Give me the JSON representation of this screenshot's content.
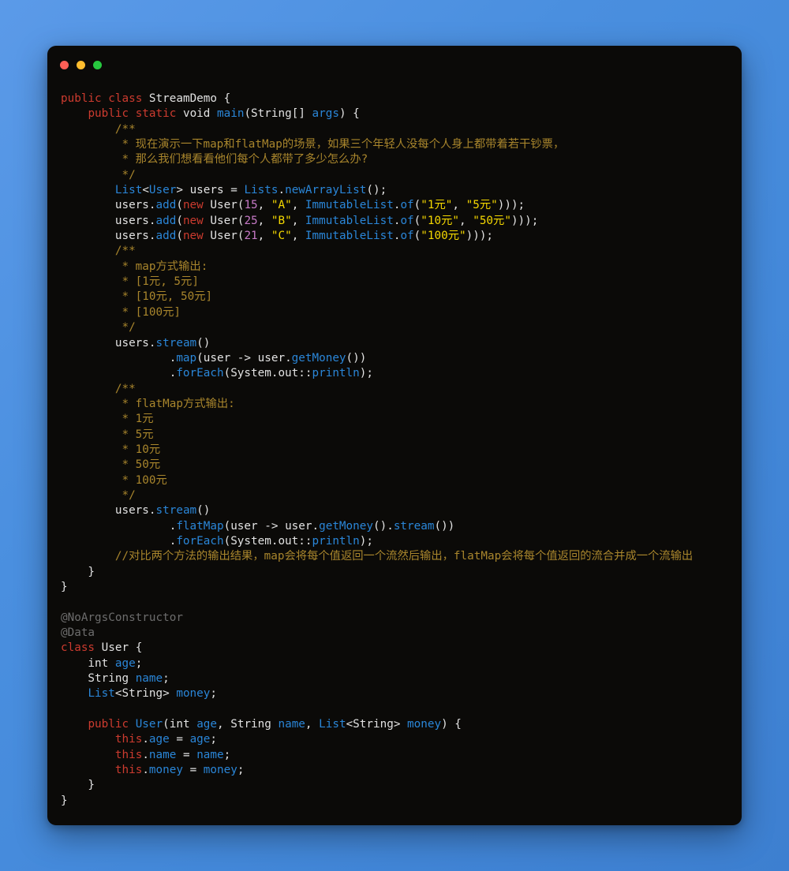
{
  "window": {
    "title": "",
    "controls": [
      {
        "name": "close-button",
        "color": "#ff5f56"
      },
      {
        "name": "minimize-button",
        "color": "#ffbd2e"
      },
      {
        "name": "maximize-button",
        "color": "#27c93f"
      }
    ]
  },
  "theme": {
    "desktop_background": "#4a90e2",
    "editor_background": "#0b0a08",
    "keyword": "#cc3b2f",
    "identifier": "#e2e2e2",
    "type_or_method": "#2a86d8",
    "string": "#f5d800",
    "number": "#c679c6",
    "comment": "#a8852c",
    "annotation": "#6d6d6d"
  },
  "code": {
    "language": "java",
    "lines": [
      [
        [
          "kw",
          "public"
        ],
        [
          "id",
          " "
        ],
        [
          "kw",
          "class"
        ],
        [
          "id",
          " StreamDemo {"
        ]
      ],
      [
        [
          "id",
          "    "
        ],
        [
          "kw",
          "public"
        ],
        [
          "id",
          " "
        ],
        [
          "kw",
          "static"
        ],
        [
          "id",
          " void "
        ],
        [
          "type",
          "main"
        ],
        [
          "id",
          "(String[] "
        ],
        [
          "type",
          "args"
        ],
        [
          "id",
          ") {"
        ]
      ],
      [
        [
          "id",
          "        "
        ],
        [
          "cmt",
          "/**"
        ]
      ],
      [
        [
          "id",
          "         "
        ],
        [
          "cmt",
          "* 现在演示一下map和flatMap的场景，如果三个年轻人没每个人身上都带着若干钞票，"
        ]
      ],
      [
        [
          "id",
          "         "
        ],
        [
          "cmt",
          "* 那么我们想看看他们每个人都带了多少怎么办?"
        ]
      ],
      [
        [
          "id",
          "         "
        ],
        [
          "cmt",
          "*/"
        ]
      ],
      [
        [
          "id",
          "        "
        ],
        [
          "type",
          "List"
        ],
        [
          "id",
          "<"
        ],
        [
          "type",
          "User"
        ],
        [
          "id",
          "> users = "
        ],
        [
          "type",
          "Lists"
        ],
        [
          "id",
          "."
        ],
        [
          "type",
          "newArrayList"
        ],
        [
          "id",
          "();"
        ]
      ],
      [
        [
          "id",
          "        users"
        ],
        [
          "id",
          "."
        ],
        [
          "type",
          "add"
        ],
        [
          "id",
          "("
        ],
        [
          "kw",
          "new"
        ],
        [
          "id",
          " User("
        ],
        [
          "num",
          "15"
        ],
        [
          "id",
          ", "
        ],
        [
          "str",
          "\"A\""
        ],
        [
          "id",
          ", "
        ],
        [
          "type",
          "ImmutableList"
        ],
        [
          "id",
          "."
        ],
        [
          "type",
          "of"
        ],
        [
          "id",
          "("
        ],
        [
          "str",
          "\"1元\""
        ],
        [
          "id",
          ", "
        ],
        [
          "str",
          "\"5元\""
        ],
        [
          "id",
          ")));"
        ]
      ],
      [
        [
          "id",
          "        users"
        ],
        [
          "id",
          "."
        ],
        [
          "type",
          "add"
        ],
        [
          "id",
          "("
        ],
        [
          "kw",
          "new"
        ],
        [
          "id",
          " User("
        ],
        [
          "num",
          "25"
        ],
        [
          "id",
          ", "
        ],
        [
          "str",
          "\"B\""
        ],
        [
          "id",
          ", "
        ],
        [
          "type",
          "ImmutableList"
        ],
        [
          "id",
          "."
        ],
        [
          "type",
          "of"
        ],
        [
          "id",
          "("
        ],
        [
          "str",
          "\"10元\""
        ],
        [
          "id",
          ", "
        ],
        [
          "str",
          "\"50元\""
        ],
        [
          "id",
          ")));"
        ]
      ],
      [
        [
          "id",
          "        users"
        ],
        [
          "id",
          "."
        ],
        [
          "type",
          "add"
        ],
        [
          "id",
          "("
        ],
        [
          "kw",
          "new"
        ],
        [
          "id",
          " User("
        ],
        [
          "num",
          "21"
        ],
        [
          "id",
          ", "
        ],
        [
          "str",
          "\"C\""
        ],
        [
          "id",
          ", "
        ],
        [
          "type",
          "ImmutableList"
        ],
        [
          "id",
          "."
        ],
        [
          "type",
          "of"
        ],
        [
          "id",
          "("
        ],
        [
          "str",
          "\"100元\""
        ],
        [
          "id",
          ")));"
        ]
      ],
      [
        [
          "id",
          "        "
        ],
        [
          "cmt",
          "/**"
        ]
      ],
      [
        [
          "id",
          "         "
        ],
        [
          "cmt",
          "* map方式输出:"
        ]
      ],
      [
        [
          "id",
          "         "
        ],
        [
          "cmt",
          "* [1元, 5元]"
        ]
      ],
      [
        [
          "id",
          "         "
        ],
        [
          "cmt",
          "* [10元, 50元]"
        ]
      ],
      [
        [
          "id",
          "         "
        ],
        [
          "cmt",
          "* [100元]"
        ]
      ],
      [
        [
          "id",
          "         "
        ],
        [
          "cmt",
          "*/"
        ]
      ],
      [
        [
          "id",
          "        users."
        ],
        [
          "type",
          "stream"
        ],
        [
          "id",
          "()"
        ]
      ],
      [
        [
          "id",
          "                ."
        ],
        [
          "type",
          "map"
        ],
        [
          "id",
          "("
        ],
        [
          "id",
          "user"
        ],
        [
          "id",
          " -> user."
        ],
        [
          "type",
          "getMoney"
        ],
        [
          "id",
          "())"
        ]
      ],
      [
        [
          "id",
          "                ."
        ],
        [
          "type",
          "forEach"
        ],
        [
          "id",
          "(System.out::"
        ],
        [
          "type",
          "println"
        ],
        [
          "id",
          ");"
        ]
      ],
      [
        [
          "id",
          "        "
        ],
        [
          "cmt",
          "/**"
        ]
      ],
      [
        [
          "id",
          "         "
        ],
        [
          "cmt",
          "* flatMap方式输出:"
        ]
      ],
      [
        [
          "id",
          "         "
        ],
        [
          "cmt",
          "* 1元"
        ]
      ],
      [
        [
          "id",
          "         "
        ],
        [
          "cmt",
          "* 5元"
        ]
      ],
      [
        [
          "id",
          "         "
        ],
        [
          "cmt",
          "* 10元"
        ]
      ],
      [
        [
          "id",
          "         "
        ],
        [
          "cmt",
          "* 50元"
        ]
      ],
      [
        [
          "id",
          "         "
        ],
        [
          "cmt",
          "* 100元"
        ]
      ],
      [
        [
          "id",
          "         "
        ],
        [
          "cmt",
          "*/"
        ]
      ],
      [
        [
          "id",
          "        users."
        ],
        [
          "type",
          "stream"
        ],
        [
          "id",
          "()"
        ]
      ],
      [
        [
          "id",
          "                ."
        ],
        [
          "type",
          "flatMap"
        ],
        [
          "id",
          "("
        ],
        [
          "id",
          "user"
        ],
        [
          "id",
          " -> user."
        ],
        [
          "type",
          "getMoney"
        ],
        [
          "id",
          "()."
        ],
        [
          "type",
          "stream"
        ],
        [
          "id",
          "())"
        ]
      ],
      [
        [
          "id",
          "                ."
        ],
        [
          "type",
          "forEach"
        ],
        [
          "id",
          "(System.out::"
        ],
        [
          "type",
          "println"
        ],
        [
          "id",
          ");"
        ]
      ],
      [
        [
          "id",
          "        "
        ],
        [
          "cmt",
          "//对比两个方法的输出结果，map会将每个值返回一个流然后输出，flatMap会将每个值返回的流合并成一个流输出"
        ]
      ],
      [
        [
          "id",
          "    }"
        ]
      ],
      [
        [
          "id",
          "}"
        ]
      ],
      [
        [
          "id",
          ""
        ]
      ],
      [
        [
          "ann",
          "@NoArgsConstructor"
        ]
      ],
      [
        [
          "ann",
          "@Data"
        ]
      ],
      [
        [
          "kw",
          "class"
        ],
        [
          "id",
          " User {"
        ]
      ],
      [
        [
          "id",
          "    int "
        ],
        [
          "type",
          "age"
        ],
        [
          "id",
          ";"
        ]
      ],
      [
        [
          "id",
          "    String "
        ],
        [
          "type",
          "name"
        ],
        [
          "id",
          ";"
        ]
      ],
      [
        [
          "id",
          "    "
        ],
        [
          "type",
          "List"
        ],
        [
          "id",
          "<String> "
        ],
        [
          "type",
          "money"
        ],
        [
          "id",
          ";"
        ]
      ],
      [
        [
          "id",
          ""
        ]
      ],
      [
        [
          "id",
          "    "
        ],
        [
          "kw",
          "public"
        ],
        [
          "id",
          " "
        ],
        [
          "type",
          "User"
        ],
        [
          "id",
          "(int "
        ],
        [
          "type",
          "age"
        ],
        [
          "id",
          ", String "
        ],
        [
          "type",
          "name"
        ],
        [
          "id",
          ", "
        ],
        [
          "type",
          "List"
        ],
        [
          "id",
          "<String> "
        ],
        [
          "type",
          "money"
        ],
        [
          "id",
          ") {"
        ]
      ],
      [
        [
          "id",
          "        "
        ],
        [
          "kw",
          "this"
        ],
        [
          "id",
          "."
        ],
        [
          "type",
          "age"
        ],
        [
          "id",
          " = "
        ],
        [
          "type",
          "age"
        ],
        [
          "id",
          ";"
        ]
      ],
      [
        [
          "id",
          "        "
        ],
        [
          "kw",
          "this"
        ],
        [
          "id",
          "."
        ],
        [
          "type",
          "name"
        ],
        [
          "id",
          " = "
        ],
        [
          "type",
          "name"
        ],
        [
          "id",
          ";"
        ]
      ],
      [
        [
          "id",
          "        "
        ],
        [
          "kw",
          "this"
        ],
        [
          "id",
          "."
        ],
        [
          "type",
          "money"
        ],
        [
          "id",
          " = "
        ],
        [
          "type",
          "money"
        ],
        [
          "id",
          ";"
        ]
      ],
      [
        [
          "id",
          "    }"
        ]
      ],
      [
        [
          "id",
          "}"
        ]
      ]
    ]
  }
}
